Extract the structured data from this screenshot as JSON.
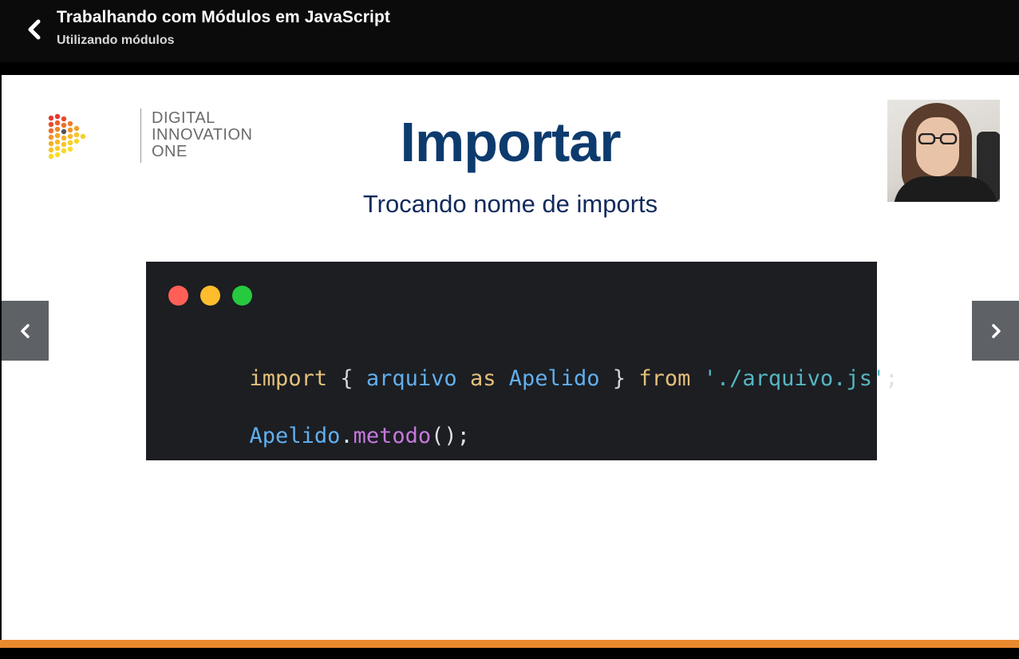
{
  "header": {
    "title": "Trabalhando com Módulos em JavaScript",
    "subtitle": "Utilizando módulos"
  },
  "slide": {
    "logo_lines": [
      "DIGITAL",
      "INNOVATION",
      "ONE"
    ],
    "title": "Importar",
    "subtitle": "Trocando nome de imports",
    "code": {
      "window_dots": [
        "#ff5f56",
        "#ffbd2e",
        "#27c93f"
      ],
      "line1": {
        "kw_import": "import",
        "brace_open": "{",
        "name": "arquivo",
        "kw_as": "as",
        "alias": "Apelido",
        "brace_close": "}",
        "kw_from": "from",
        "path": "'./arquivo.js'",
        "semi": ";"
      },
      "line2": {
        "obj": "Apelido",
        "dot": ".",
        "method": "metodo",
        "call": "();"
      },
      "colors": {
        "keyword": "#e5c07b",
        "identifier": "#61afef",
        "string": "#56b6c2",
        "method": "#c678dd",
        "punct": "#dcdfe4",
        "brace": "#d4d4d4"
      }
    }
  },
  "colors": {
    "accent_bar": "#ea8a2e",
    "title_blue": "#0d3b6e"
  },
  "icons": {
    "back": "chevron-left-icon",
    "prev": "chevron-left-icon",
    "next": "chevron-right-icon"
  }
}
